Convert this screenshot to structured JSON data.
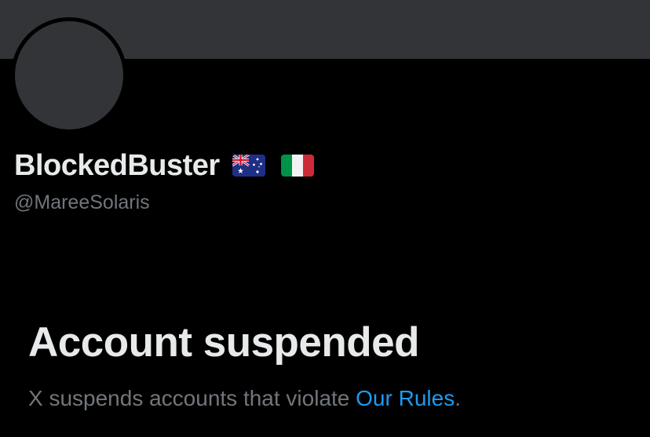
{
  "profile": {
    "display_name": "BlockedBuster",
    "flags": [
      "australia-flag-icon",
      "italy-flag-icon"
    ],
    "username": "@MareeSolaris"
  },
  "suspension": {
    "title": "Account suspended",
    "description_prefix": "X suspends accounts that violate ",
    "rules_link": "Our Rules",
    "description_suffix": "."
  },
  "colors": {
    "background": "#000000",
    "banner": "#323437",
    "avatar": "#323437",
    "primary_text": "#e7e9ea",
    "secondary_text": "#71767b",
    "link": "#1d9bf0"
  }
}
